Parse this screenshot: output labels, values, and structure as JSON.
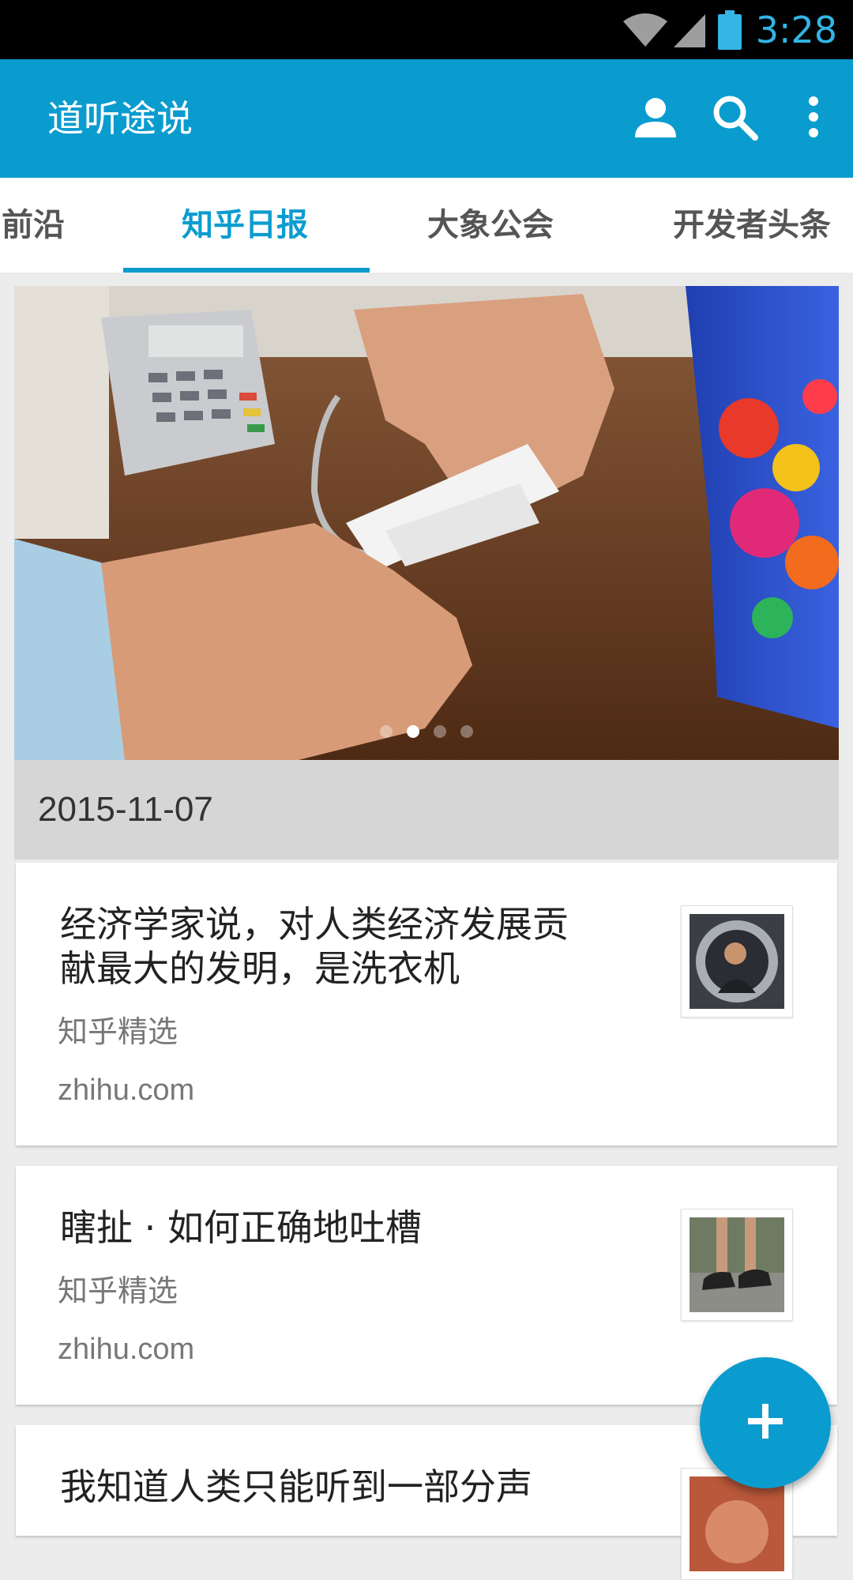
{
  "status_bar": {
    "time": "3:28",
    "icons": [
      "wifi-icon",
      "cell-signal-icon",
      "battery-icon"
    ],
    "time_color": "#33b5e5"
  },
  "app_bar": {
    "title": "道听途说",
    "color": "#0b9ccf",
    "actions": [
      "account-icon",
      "search-icon",
      "more-vert-icon"
    ]
  },
  "tabs": {
    "items": [
      {
        "label": "前沿"
      },
      {
        "label": "知乎日报"
      },
      {
        "label": "大象公会"
      },
      {
        "label": "开发者头条"
      }
    ],
    "active_index": 1
  },
  "banner": {
    "page_count": 4,
    "active_page": 2
  },
  "date_header": "2015-11-07",
  "feed": [
    {
      "title": "经济学家说，对人类经济发展贡献最大的发明，是洗衣机",
      "source": "知乎精选",
      "domain": "zhihu.com"
    },
    {
      "title": "瞎扯 · 如何正确地吐槽",
      "source": "知乎精选",
      "domain": "zhihu.com"
    },
    {
      "title": "我知道人类只能听到一部分声"
    }
  ],
  "fab": {
    "icon": "add-icon"
  }
}
